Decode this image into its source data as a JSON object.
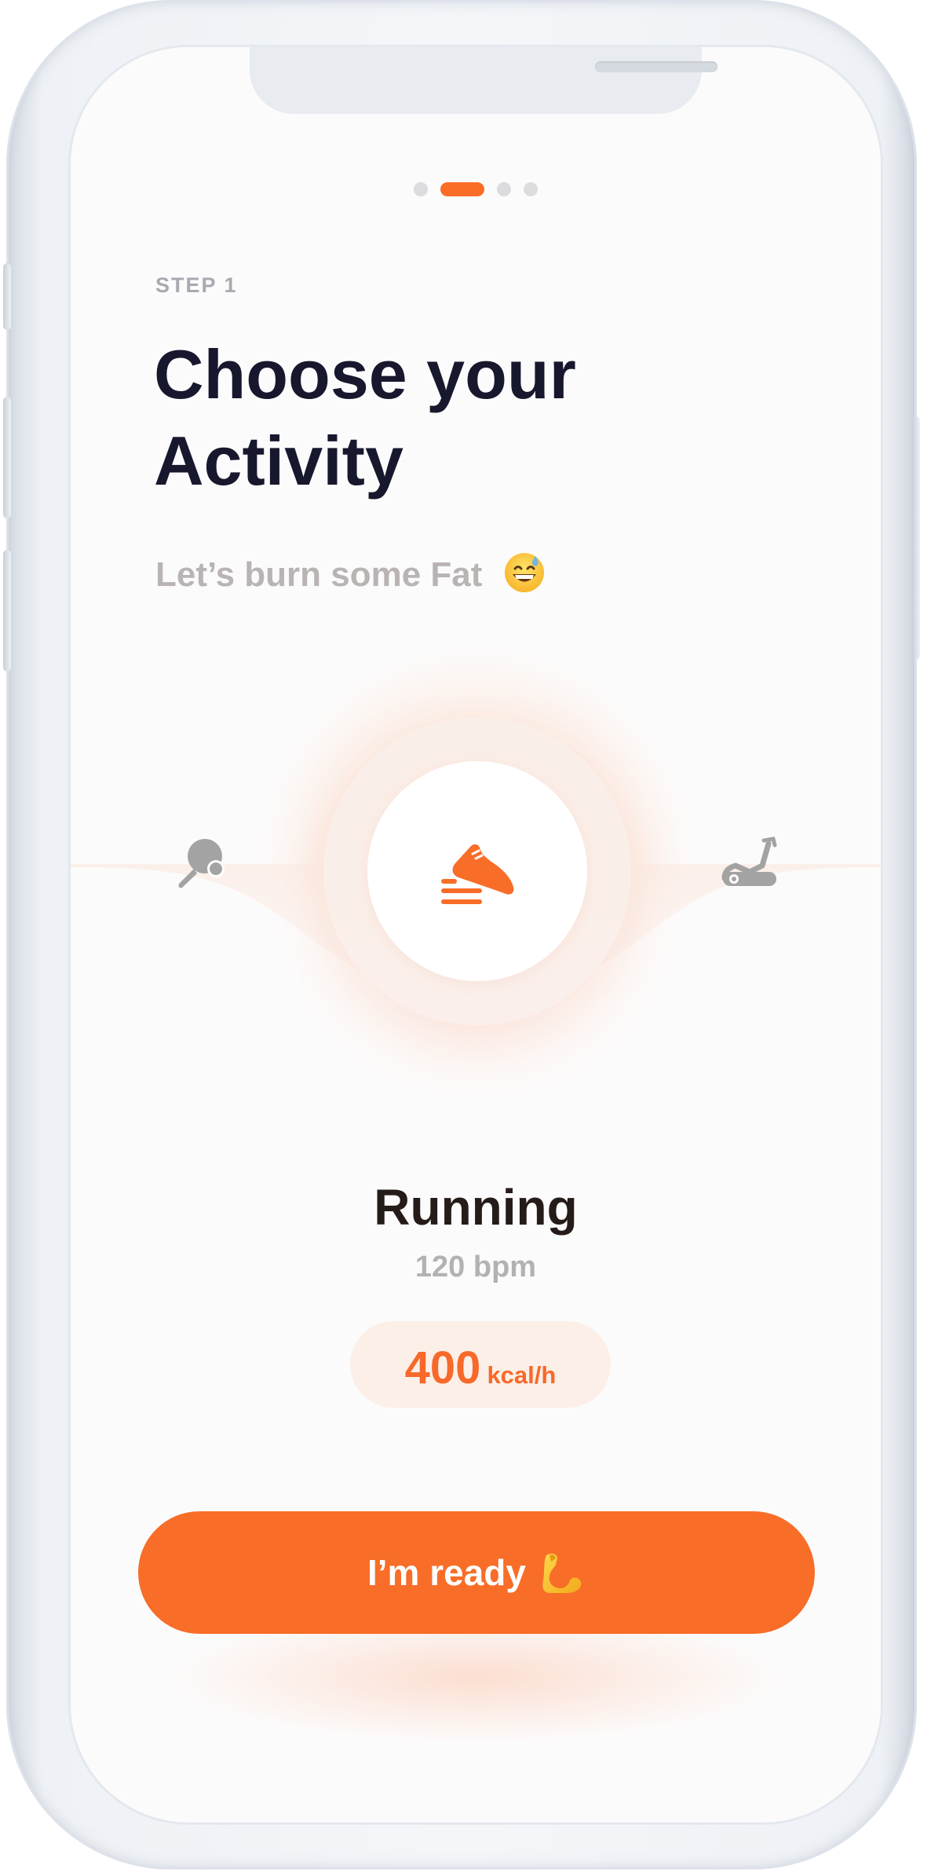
{
  "onboarding": {
    "pager": {
      "total_pages": 4,
      "current_page": 2
    },
    "step_label": "STEP 1",
    "title_line1": "Choose your",
    "title_line2": "Activity",
    "subtitle": "Let’s burn some Fat",
    "subtitle_emoji": "grinning-face-with-sweat-icon"
  },
  "activity_picker": {
    "left_icon": "table-tennis-icon",
    "center_icon": "running-shoe-icon",
    "right_icon": "exercise-bike-icon",
    "selected": {
      "name": "Running",
      "bpm": "120 bpm",
      "kcal_value": "400",
      "kcal_unit": "kcal/h"
    }
  },
  "cta": {
    "label": "I’m ready",
    "emoji": "flexed-biceps-icon"
  },
  "colors": {
    "accent": "#f86d27",
    "accent_light": "#fcefe8",
    "title": "#17182e",
    "muted": "#b9b4b3",
    "icon_gray": "#a3a3a3"
  }
}
